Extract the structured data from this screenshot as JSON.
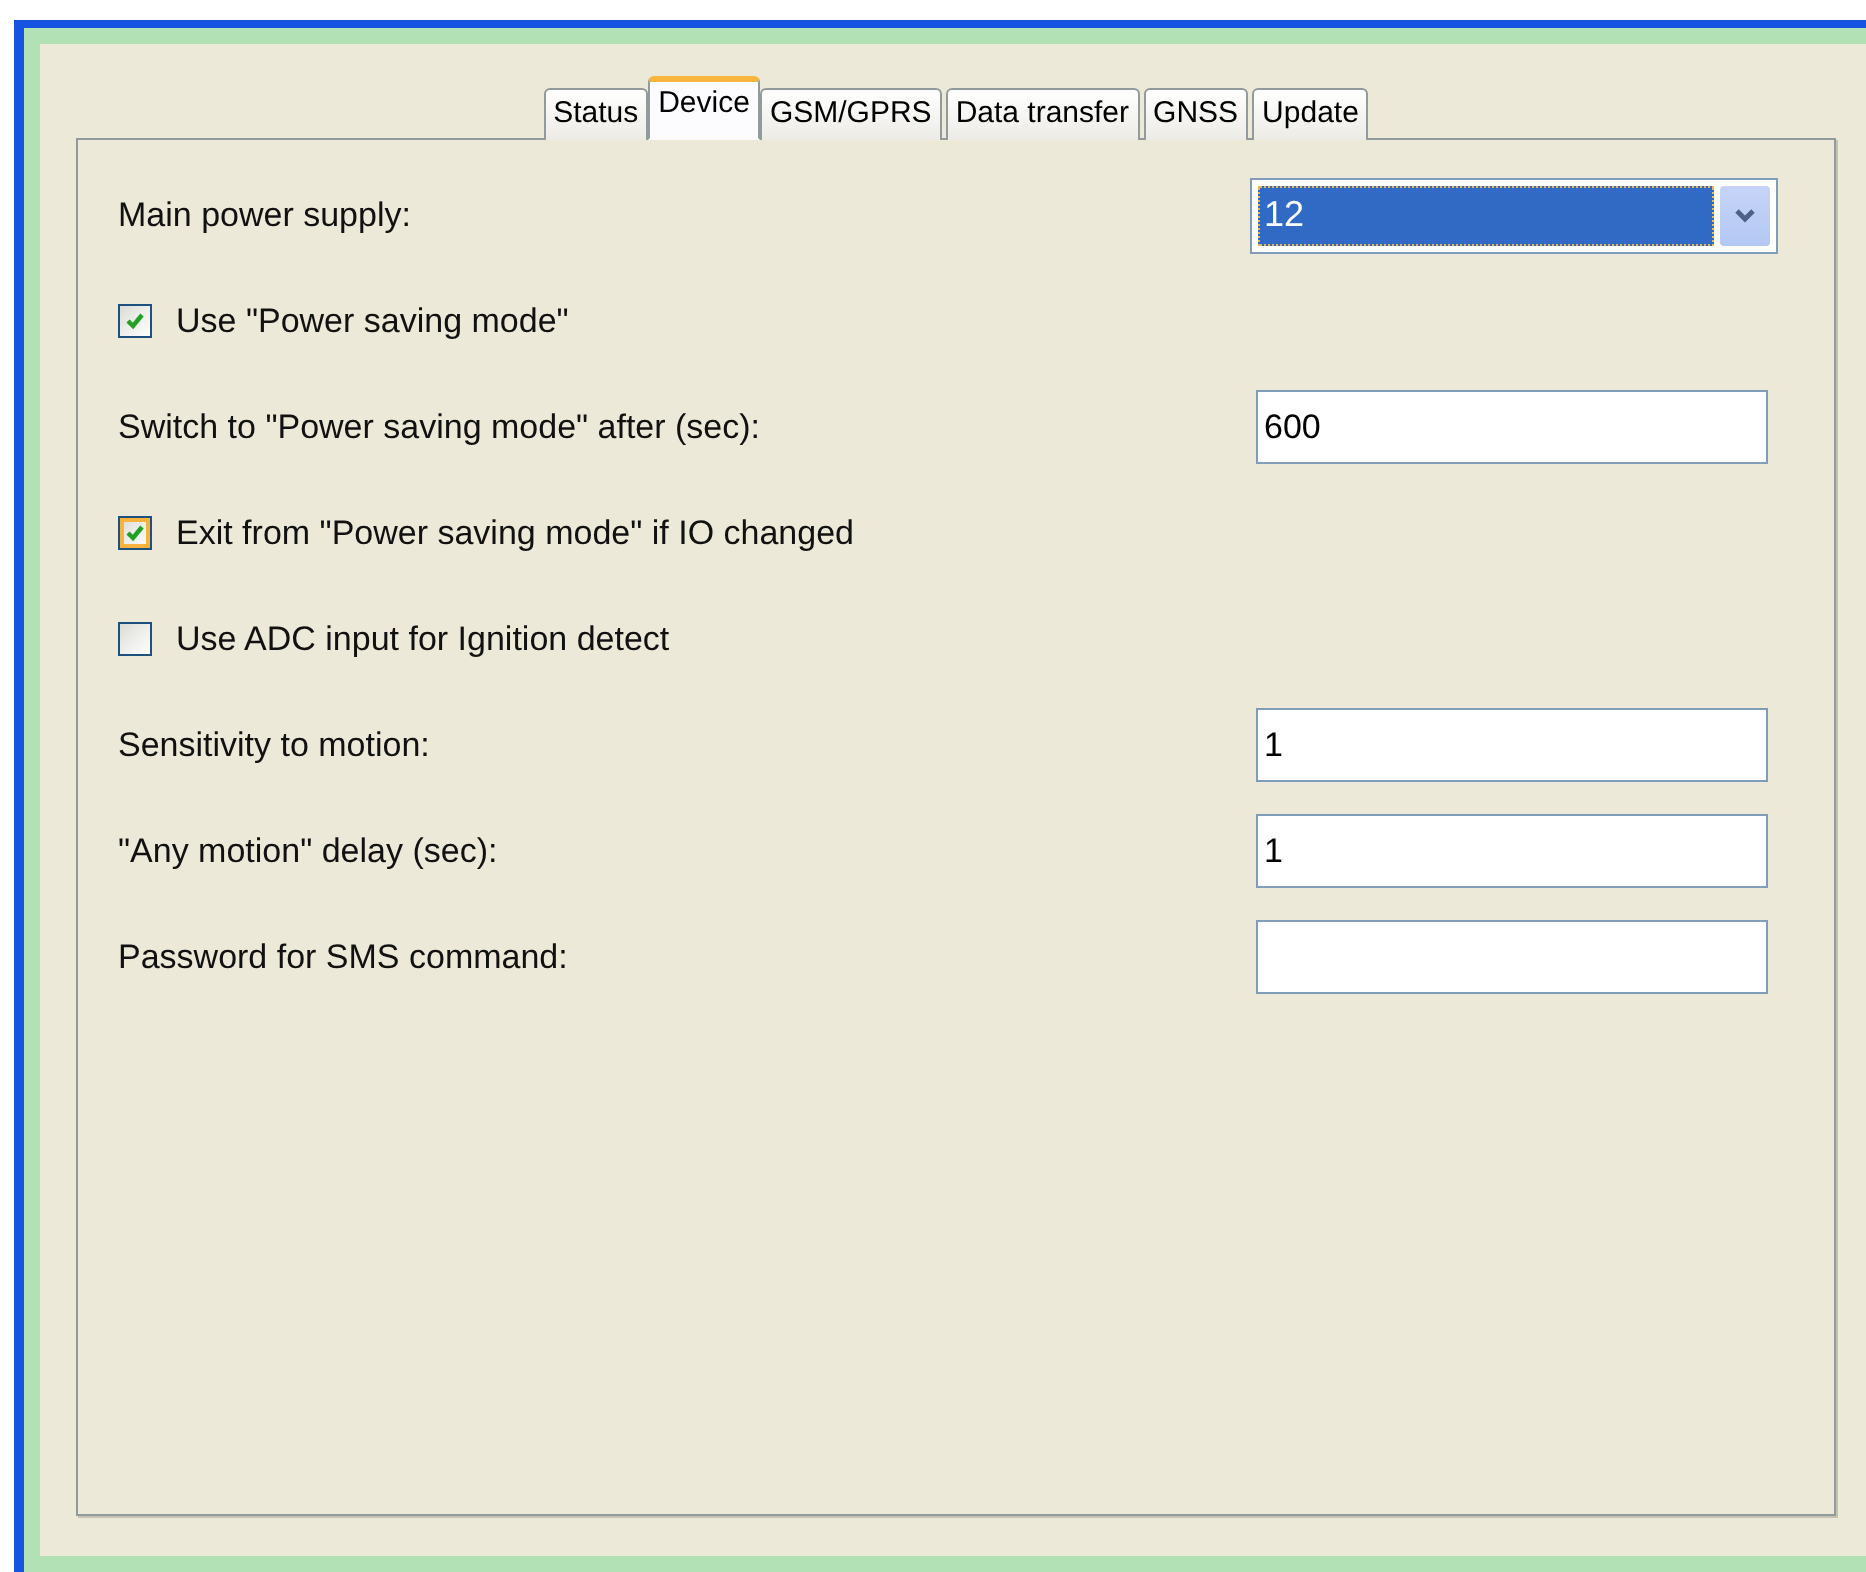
{
  "tabs": [
    {
      "label": "Status",
      "selected": false
    },
    {
      "label": "Device",
      "selected": true
    },
    {
      "label": "GSM/GPRS",
      "selected": false
    },
    {
      "label": "Data transfer",
      "selected": false
    },
    {
      "label": "GNSS",
      "selected": false
    },
    {
      "label": "Update",
      "selected": false
    }
  ],
  "settings": [
    {
      "kind": "select",
      "label": "Main power supply:",
      "value": "12"
    },
    {
      "kind": "checkbox",
      "label": "Use \"Power saving mode\"",
      "checked": true,
      "hovered": false
    },
    {
      "kind": "text",
      "label": "Switch to \"Power saving mode\" after (sec):",
      "value": "600"
    },
    {
      "kind": "checkbox",
      "label": "Exit from \"Power saving mode\" if IO changed",
      "checked": true,
      "hovered": true
    },
    {
      "kind": "checkbox",
      "label": "Use ADC input for Ignition detect",
      "checked": false,
      "hovered": false
    },
    {
      "kind": "text",
      "label": "Sensitivity to motion:",
      "value": "1"
    },
    {
      "kind": "text",
      "label": "\"Any motion\" delay (sec):",
      "value": "1"
    },
    {
      "kind": "text",
      "label": "Password for SMS command:"
    }
  ]
}
